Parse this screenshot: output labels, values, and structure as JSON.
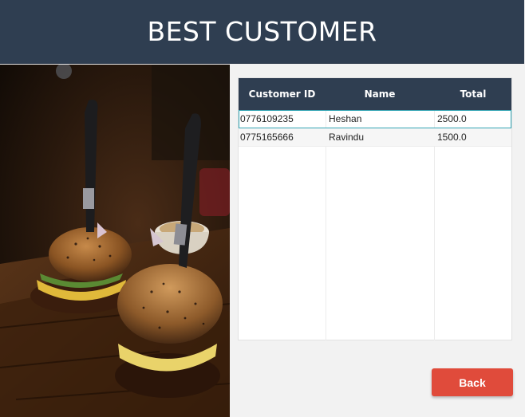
{
  "header": {
    "title": "BEST CUSTOMER"
  },
  "table": {
    "columns": [
      "Customer ID",
      "Name",
      "Total"
    ],
    "rows": [
      {
        "id": "0776109235",
        "name": "Heshan",
        "total": "2500.0",
        "selected": true
      },
      {
        "id": "0775165666",
        "name": "Ravindu",
        "total": "1500.0",
        "selected": false
      }
    ]
  },
  "actions": {
    "back_label": "Back"
  },
  "colors": {
    "header_bg": "#2f3e51",
    "back_button": "#e04b3b",
    "selection_outline": "#33a4b3"
  },
  "image": {
    "subject": "burgers-on-wooden-board"
  }
}
